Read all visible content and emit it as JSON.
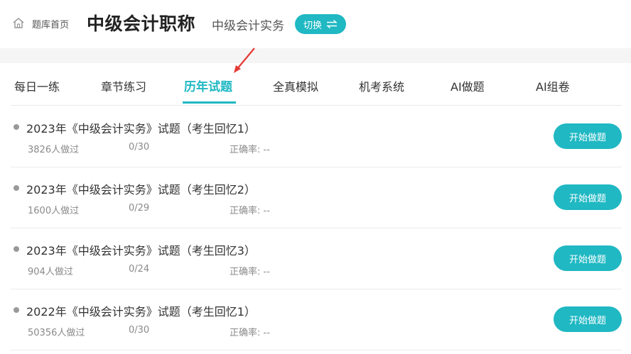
{
  "header": {
    "home_label": "题库首页",
    "title": "中级会计职称",
    "subject": "中级会计实务",
    "switch_label": "切换"
  },
  "tabs": [
    {
      "label": "每日一练",
      "active": false
    },
    {
      "label": "章节练习",
      "active": false
    },
    {
      "label": "历年试题",
      "active": true
    },
    {
      "label": "全真模拟",
      "active": false
    },
    {
      "label": "机考系统",
      "active": false
    },
    {
      "label": "AI做题",
      "active": false
    },
    {
      "label": "AI组卷",
      "active": false
    }
  ],
  "exams": [
    {
      "title": "2023年《中级会计实务》试题（考生回忆1）",
      "people": "3826人做过",
      "progress": "0/30",
      "accuracy_label": "正确率:",
      "accuracy_value": "--",
      "button": "开始做题"
    },
    {
      "title": "2023年《中级会计实务》试题（考生回忆2）",
      "people": "1600人做过",
      "progress": "0/29",
      "accuracy_label": "正确率:",
      "accuracy_value": "--",
      "button": "开始做题"
    },
    {
      "title": "2023年《中级会计实务》试题（考生回忆3）",
      "people": "904人做过",
      "progress": "0/24",
      "accuracy_label": "正确率:",
      "accuracy_value": "--",
      "button": "开始做题"
    },
    {
      "title": "2022年《中级会计实务》试题（考生回忆1）",
      "people": "50356人做过",
      "progress": "0/30",
      "accuracy_label": "正确率:",
      "accuracy_value": "--",
      "button": "开始做题"
    }
  ],
  "colors": {
    "accent": "#1fb8c3",
    "annotation_arrow": "#e53935"
  },
  "icons": {
    "home": "home-icon",
    "switch": "swap-arrows-icon"
  }
}
